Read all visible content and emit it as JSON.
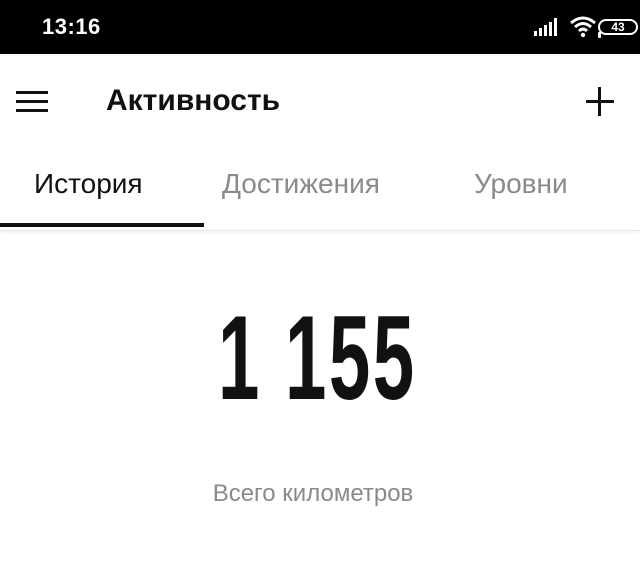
{
  "status_bar": {
    "time": "13:16",
    "battery": "43",
    "icons": [
      "signal-icon",
      "wifi-icon",
      "battery-icon"
    ]
  },
  "toolbar": {
    "title": "Активность",
    "menu_icon": "hamburger-menu-icon",
    "add_icon": "plus-icon"
  },
  "tabs": [
    {
      "label": "История",
      "active": true
    },
    {
      "label": "Достижения",
      "active": false
    },
    {
      "label": "Уровни",
      "active": false
    }
  ],
  "summary": {
    "value": "1 155",
    "label": "Всего километров"
  },
  "colors": {
    "text_primary": "#111111",
    "text_secondary": "#8a8a8a",
    "status_bar_bg": "#000000",
    "background": "#ffffff"
  }
}
